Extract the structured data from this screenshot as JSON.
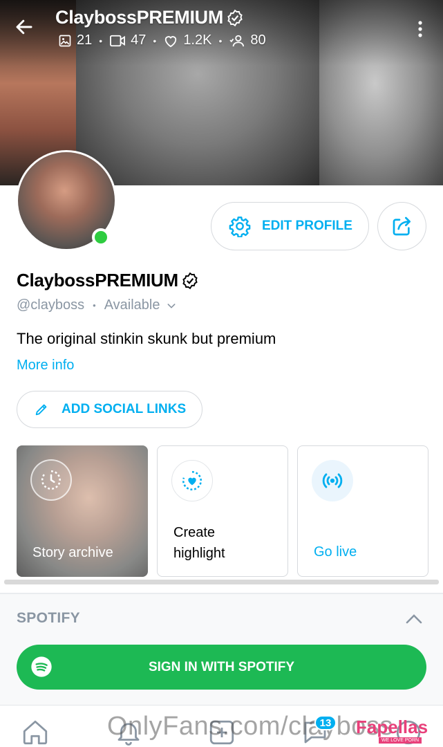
{
  "header": {
    "title": "ClaybossPREMIUM",
    "stats": {
      "photos": "21",
      "videos": "47",
      "likes": "1.2K",
      "fans": "80"
    },
    "icons": [
      "arrow-left-icon",
      "image-icon",
      "video-icon",
      "heart-icon",
      "user-icon",
      "more-vertical-icon"
    ]
  },
  "profile": {
    "name": "ClaybossPREMIUM",
    "handle": "@clayboss",
    "status": "Available",
    "bio": "The original stinkin skunk but premium",
    "more_info": "More info",
    "edit_label": "EDIT PROFILE",
    "social_label": "ADD SOCIAL LINKS"
  },
  "cards": {
    "story_archive": "Story archive",
    "create_highlight": "Create highlight",
    "go_live": "Go live"
  },
  "spotify": {
    "section_title": "SPOTIFY",
    "sign_in_label": "SIGN IN WITH SPOTIFY"
  },
  "bottom_nav": {
    "messages_badge": "13",
    "watermark": "OnlyFans.com/clayboss",
    "brand": "Fapellas",
    "brand_tagline": "WE LOVE PORN"
  },
  "colors": {
    "accent": "#00aff0",
    "online": "#2ecc40",
    "spotify": "#1db954",
    "muted": "#8a96a3"
  }
}
